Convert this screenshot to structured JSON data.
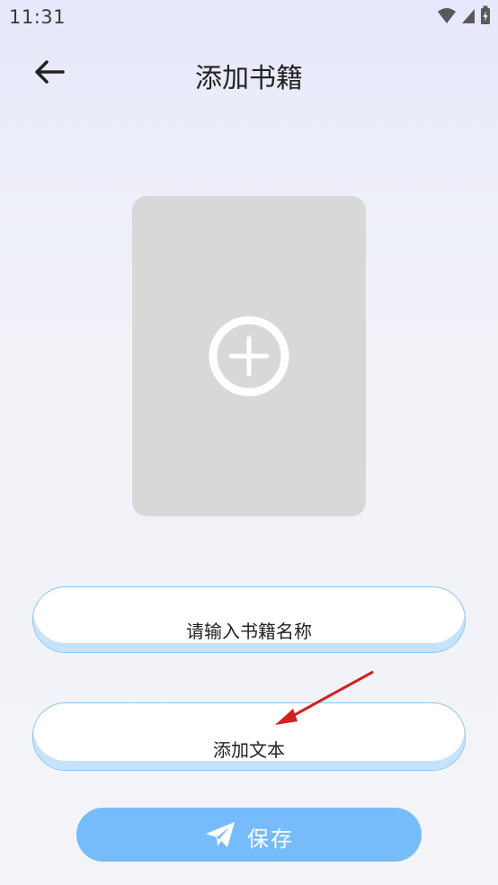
{
  "status_bar": {
    "time": "11:31"
  },
  "header": {
    "title": "添加书籍"
  },
  "form": {
    "book_name_placeholder": "请输入书籍名称",
    "add_text_label": "添加文本",
    "save_label": "保存"
  },
  "colors": {
    "accent": "#76bcfb",
    "pill_border": "#8cc4f3",
    "annotation_arrow": "#d32020"
  }
}
